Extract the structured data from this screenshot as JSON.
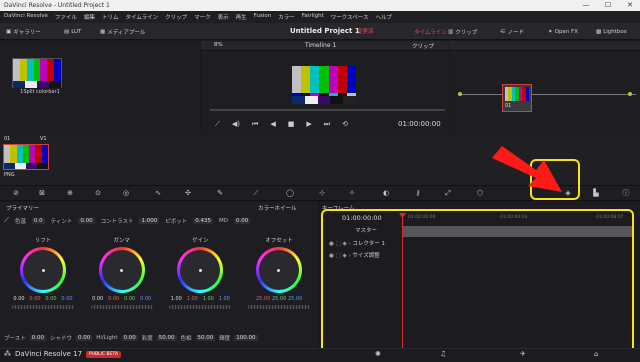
{
  "window": {
    "title": "DaVinci Resolve - Untitled Project 1",
    "controls": [
      "—",
      "☐",
      "✕"
    ]
  },
  "menu": [
    "DaVinci Resolve",
    "ファイル",
    "編集",
    "トリム",
    "タイムライン",
    "クリップ",
    "マーク",
    "表示",
    "再生",
    "Fusion",
    "カラー",
    "Fairlight",
    "ワークスペース",
    "ヘルプ"
  ],
  "toolbar": {
    "gallery": "ギャラリー",
    "lut": "LUT",
    "media_pool": "メディアプール",
    "project_title": "Untitled Project 1",
    "edited": "変更済",
    "timeline_btn": "タイムライン",
    "clips": "クリップ",
    "nodes": "ノード",
    "openfx": "Open FX",
    "lightbox": "Lightbox"
  },
  "viewer": {
    "zoom": "8%",
    "timeline_name": "Timeline 1",
    "timecode": "01:00:00:00",
    "clip_mode": "クリップ"
  },
  "media": {
    "clip_name": "1Split colorbar1",
    "thumb_num": "01",
    "thumb_track": "V1",
    "thumb_format": "PNG",
    "node_label": "01"
  },
  "colors": {
    "accent": "#d04040",
    "highlight": "#f7e316",
    "arrow": "#ff1a1a"
  },
  "primaries": {
    "label": "プライマリー",
    "mode": "カラーホイール",
    "keyframe_label": "キーフレーム"
  },
  "params": [
    {
      "label": "色温",
      "value": "0.0"
    },
    {
      "label": "ティント",
      "value": "0.00"
    },
    {
      "label": "コントラスト",
      "value": "1.000"
    },
    {
      "label": "ピボット",
      "value": "0.435"
    },
    {
      "label": "MD",
      "value": "0.00"
    }
  ],
  "wheels": [
    {
      "label": "リフト",
      "values": [
        "0.00",
        "0.00",
        "0.00",
        "0.00"
      ]
    },
    {
      "label": "ガンマ",
      "values": [
        "0.00",
        "0.00",
        "0.00",
        "0.00"
      ]
    },
    {
      "label": "ゲイン",
      "values": [
        "1.00",
        "1.00",
        "1.00",
        "1.00"
      ]
    },
    {
      "label": "オフセット",
      "values": [
        "25.00",
        "25.00",
        "25.00",
        ""
      ]
    }
  ],
  "bottom_params": [
    {
      "label": "ブースト",
      "value": "0.00"
    },
    {
      "label": "シャドウ",
      "value": "0.00"
    },
    {
      "label": "Hi/Light",
      "value": "0.00"
    },
    {
      "label": "彩度",
      "value": "50.00"
    },
    {
      "label": "色相",
      "value": "50.00"
    },
    {
      "label": "輝度",
      "value": "100.00"
    }
  ],
  "keyframes": {
    "timecode": "01:00:00:00",
    "ticks": [
      "01:00:00:00",
      "01:00:04:03",
      "01:00:08:07"
    ],
    "rows": [
      "マスター",
      "コレクター 1",
      "サイズ調整"
    ]
  },
  "status": {
    "app": "DaVinci Resolve 17",
    "beta": "PUBLIC BETA"
  }
}
